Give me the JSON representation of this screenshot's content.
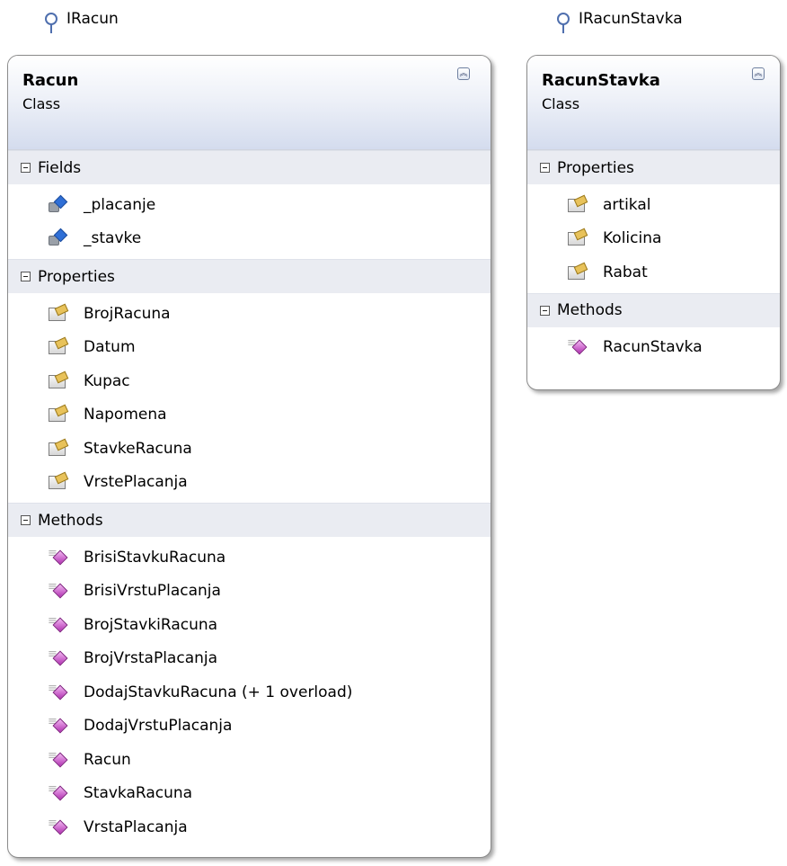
{
  "interfaces": [
    {
      "name": "IRacun"
    },
    {
      "name": "IRacunStavka"
    }
  ],
  "classes": [
    {
      "name": "Racun",
      "kind": "Class",
      "sections": [
        {
          "title": "Fields",
          "member_icon": "field-icon",
          "members": [
            "_placanje",
            "_stavke"
          ]
        },
        {
          "title": "Properties",
          "member_icon": "property-icon",
          "members": [
            "BrojRacuna",
            "Datum",
            "Kupac",
            "Napomena",
            "StavkeRacuna",
            "VrstePlacanja"
          ]
        },
        {
          "title": "Methods",
          "member_icon": "method-icon",
          "members": [
            "BrisiStavkuRacuna",
            "BrisiVrstuPlacanja",
            "BrojStavkiRacuna",
            "BrojVrstaPlacanja",
            "DodajStavkuRacuna (+ 1 overload)",
            "DodajVrstuPlacanja",
            "Racun",
            "StavkaRacuna",
            "VrstaPlacanja"
          ]
        }
      ]
    },
    {
      "name": "RacunStavka",
      "kind": "Class",
      "sections": [
        {
          "title": "Properties",
          "member_icon": "property-icon",
          "members": [
            "artikal",
            "Kolicina",
            "Rabat"
          ]
        },
        {
          "title": "Methods",
          "member_icon": "method-icon",
          "members": [
            "RacunStavka"
          ]
        }
      ]
    }
  ],
  "colors": {
    "interface_line": "#4f6fae",
    "header_gradient_end": "#d4dcee",
    "section_band": "#eaecf2"
  }
}
